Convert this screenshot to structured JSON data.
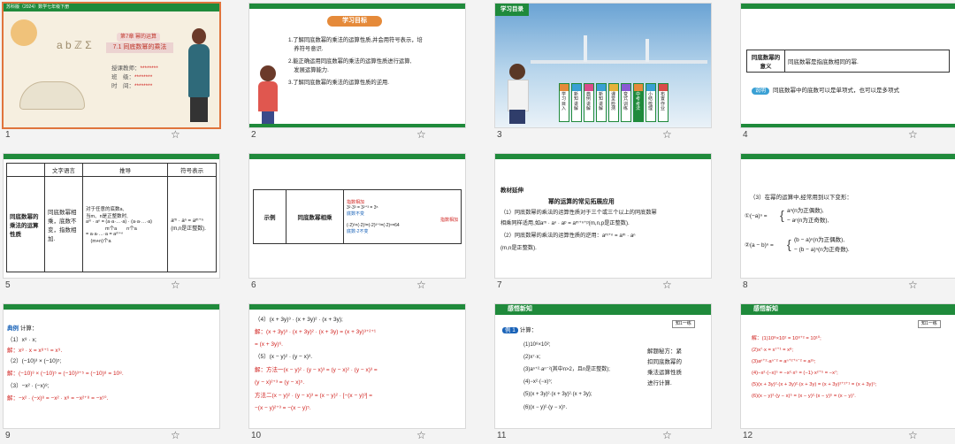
{
  "slides": [
    {
      "num": "1",
      "header": "苏科版（2024）数学七年级下册",
      "chapter": "第7章 幂的运算",
      "title": "7.1 同底数幂的乘法",
      "teacher": "授课教师：",
      "class_label": "班　级：",
      "time": "时　间：",
      "mask": "********"
    },
    {
      "num": "2",
      "heading": "学习目标",
      "lines": [
        "1.了解同底数幂的乘法的运算性质,并会用符号表示，培",
        "　养符号意识.",
        "2.能正确运用同底数幂的乘法的运算性质进行运算,",
        "　发展运算能力.",
        "3.了解同底数幂的乘法的运算性质的逆用."
      ]
    },
    {
      "num": "3",
      "tab": "学习目录",
      "items": [
        "学习目入",
        "新知讲解",
        "典例讲解",
        "新知讲解",
        "课堂检测",
        "变式训练",
        "中考考法",
        "小结梳理",
        "布置作业"
      ]
    },
    {
      "num": "4",
      "term": "同底数幂的意义",
      "def": "同底数幂是指底数相同的幂.",
      "note_tag": "说明",
      "note": "同底数幂中的底数可以是单项式，也可以是多项式"
    },
    {
      "num": "5",
      "headers": [
        "文字语言",
        "推导",
        "符号表示"
      ],
      "rowlabel": "同底数幂的乘法的运算性质",
      "text": "同底数幂相乘，底数不变，指数相加.",
      "deriv": [
        "对于任意的底数a,",
        "当m、n是正整数时,",
        "aᵐ · aⁿ = (a·a·…·a) · (a·a·…·a)",
        "　　　　m个a　　n个a",
        "= a·a·…·a = aᵐ⁺ⁿ",
        "　(m+n)个a"
      ],
      "symbol": "aᵐ · aⁿ = aᵐ⁺ⁿ",
      "cond": "(m,n是正整数)."
    },
    {
      "num": "6",
      "label": "示例",
      "name": "同底数幂相乘",
      "ex1": "3²·3³ = 3²⁺³ = 3⁵",
      "ex1_note": "底数不变",
      "ex1_top": "指数相加",
      "ex2": "(-2)³×(-2)³=(-2)³⁺³=(-2)⁶=64",
      "ex2_note": "底数-2不变",
      "ex2_top": "指数相加"
    },
    {
      "num": "7",
      "tag": "教材延伸",
      "title": "幂的运算的常见拓展应用",
      "lines": [
        "（1）同底数幂的乘法的运算性质对于三个或三个以上的同底数幂",
        "相乘同样适用,如aᵐ · aⁿ · aᵖ = aᵐ⁺ⁿ⁺ᵖ(m,n,p是正整数).",
        "（2）同底数幂的乘法的运算性质的逆用：aᵐ⁺ⁿ = aᵐ · aⁿ",
        "(m,n是正整数)."
      ]
    },
    {
      "num": "8",
      "intro": "（3）在幂的运算中,经常用到以下变形：",
      "f1a": "aⁿ(n为正偶数),",
      "f1b": "− aⁿ(n为正奇数),",
      "f1lhs": "①(−a)ⁿ =",
      "f2a": "(b − a)ⁿ(n为正偶数),",
      "f2b": "− (b − a)ⁿ(n为正奇数).",
      "f2lhs": "②(a − b)ⁿ ="
    },
    {
      "num": "9",
      "tag": "典例",
      "task": "计算：",
      "lines": [
        "（1）x⁸ · x;",
        "解：x⁸ · x = x⁸⁺¹ = x⁹.",
        "（2）(−10)³ × (−10)⁵;",
        "解：(−10)³ × (−10)⁵ = (−10)³⁺⁵ = (−10)⁸ = 10⁸.",
        "（3）−x² · (−x)⁸;",
        "解：−x² · (−x)⁸ = −x² · x⁸ = −x²⁺⁸ = −x¹⁰."
      ]
    },
    {
      "num": "10",
      "lines": [
        "（4）(x + 3y)³ · (x + 3y)² · (x + 3y);",
        "解：(x + 3y)³ · (x + 3y)² · (x + 3y) = (x + 3y)³⁺²⁺¹",
        "= (x + 3y)⁶.",
        "（5）(x − y)² · (y − x)³.",
        "解：方法一(x − y)² · (y − x)³ = (y − x)² · (y − x)³ =",
        "(y − x)²⁺³ = (y − x)⁵.",
        "方法二(x − y)² · (y − x)³ = (x − y)² · [−(x − y)³] =",
        "−(x − y)²⁺³ = −(x − y)⁵."
      ]
    },
    {
      "num": "11",
      "tab": "感悟新知",
      "badge": "知1一练",
      "tag": "例 1",
      "task": "计算：",
      "lines": [
        "(1)10⁸×10²;",
        "(2)x⁷·x;",
        "(3)aⁿ⁺²·aⁿ⁻²(其中n>2，且n是正整数);",
        "(4)−x²·(−x)⁵;",
        "(5)(x + 3y)²·(x + 3y)²·(x + 3y);",
        "(6)(x − y)²·(y − x)⁵."
      ],
      "hint": [
        "解题秘方：紧",
        "扣同底数幂的",
        "乘法运算性质",
        "进行计算."
      ]
    },
    {
      "num": "12",
      "tab": "感悟新知",
      "badge": "知1一练",
      "lines": [
        "解：(1)10⁸×10² = 10⁸⁺² = 10¹⁰;",
        "(2)x⁷·x = x⁷⁺¹ = x⁸;",
        "(3)aⁿ⁺²·aⁿ⁻² = aⁿ⁺²⁺ⁿ⁻² = a²ⁿ;",
        "(4)−x²·(−x)⁵ = −x²·x⁵ = (−1)·x²⁺⁵ = −x⁷;",
        "(5)(x + 3y)²·(x + 3y)²·(x + 3y) = (x + 3y)²⁺²⁺¹ = (x + 3y)⁵;",
        "(6)(x − y)²·(y − x)⁵ = (x − y)²·(x − y)⁵ = (x − y)⁷."
      ]
    }
  ],
  "star": "☆",
  "colors": {
    "green": "#1f8a3b",
    "red": "#d0211e",
    "orange": "#e0743c"
  }
}
